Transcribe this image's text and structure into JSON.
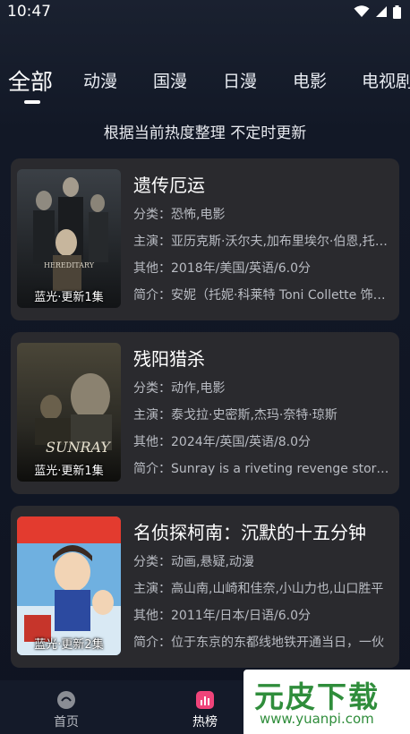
{
  "status_bar": {
    "time": "10:47"
  },
  "tabs": [
    {
      "label": "全部",
      "active": true
    },
    {
      "label": "动漫"
    },
    {
      "label": "国漫"
    },
    {
      "label": "日漫"
    },
    {
      "label": "电影"
    },
    {
      "label": "电视剧"
    }
  ],
  "subtitle": "根据当前热度整理 不定时更新",
  "movies": [
    {
      "title": "遗传厄运",
      "badge": "蓝光·更新1集",
      "poster_text": "HEREDITARY",
      "category": "分类：恐怖,电影",
      "cast": "主演：亚历克斯·沃尔夫,加布里埃尔·伯恩,托妮·科莱特",
      "other": "其他：2018年/美国/英语/6.0分",
      "intro": "简介：安妮（托妮·科莱特 Toni Collette 饰）一家"
    },
    {
      "title": "残阳猎杀",
      "badge": "蓝光·更新1集",
      "poster_text": "SUNRAY",
      "category": "分类：动作,电影",
      "cast": "主演：泰戈拉·史密斯,杰玛·奈特·琼斯",
      "other": "其他：2024年/英国/英语/8.0分",
      "intro": "简介：Sunray is a riveting revenge story set"
    },
    {
      "title": "名侦探柯南：沉默的十五分钟",
      "badge": "蓝光·更新2集",
      "poster_text": "",
      "category": "分类：动画,悬疑,动漫",
      "cast": "主演：高山南,山崎和佳奈,小山力也,山口胜平",
      "other": "其他：2011年/日本/日语/6.0分",
      "intro": "简介：位于东京的东都线地铁开通当日，一伙"
    }
  ],
  "bottom_nav": [
    {
      "label": "首页",
      "icon": "home-icon",
      "active": false
    },
    {
      "label": "热榜",
      "icon": "chart-icon",
      "active": true
    }
  ],
  "watermark": {
    "logo": "元皮下载",
    "url": "www.yuanpi.com"
  }
}
